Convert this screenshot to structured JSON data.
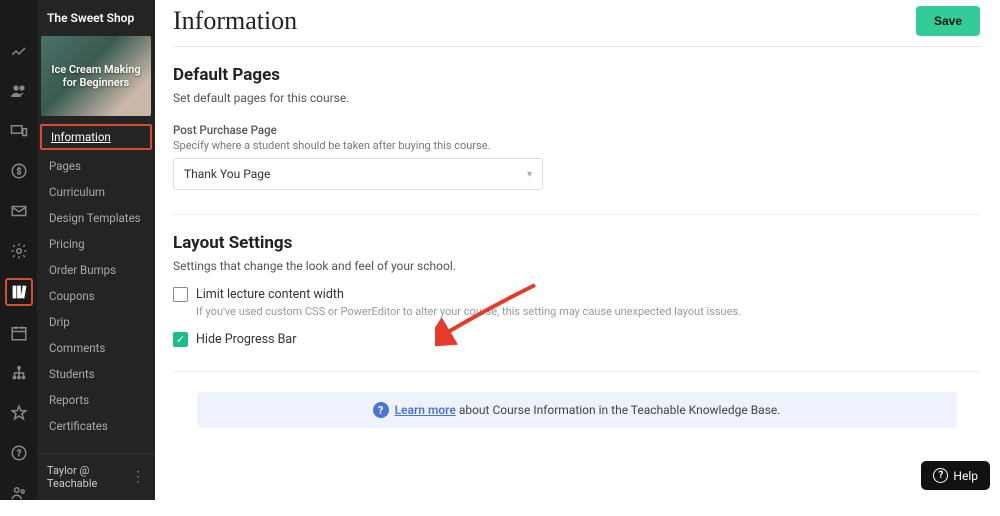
{
  "brand": "The Sweet Shop",
  "course_card": {
    "title": "Ice Cream Making for Beginners"
  },
  "nav": {
    "information": "Information",
    "pages": "Pages",
    "curriculum": "Curriculum",
    "design_templates": "Design Templates",
    "pricing": "Pricing",
    "order_bumps": "Order Bumps",
    "coupons": "Coupons",
    "drip": "Drip",
    "comments": "Comments",
    "students": "Students",
    "reports": "Reports",
    "certificates": "Certificates"
  },
  "footer_user": "Taylor @ Teachable",
  "page": {
    "title": "Information",
    "save": "Save"
  },
  "default_pages": {
    "heading": "Default Pages",
    "sub": "Set default pages for this course.",
    "post_purchase_label": "Post Purchase Page",
    "post_purchase_help": "Specify where a student should be taken after buying this course.",
    "post_purchase_value": "Thank You Page"
  },
  "layout": {
    "heading": "Layout Settings",
    "sub": "Settings that change the look and feel of your school.",
    "limit_width_label": "Limit lecture content width",
    "limit_width_help": "If you've used custom CSS or PowerEditor to alter your course, this setting may cause unexpected layout issues.",
    "hide_progress_label": "Hide Progress Bar"
  },
  "info_bar": {
    "link": "Learn more",
    "text": " about Course Information in the Teachable Knowledge Base."
  },
  "help_button": "Help"
}
